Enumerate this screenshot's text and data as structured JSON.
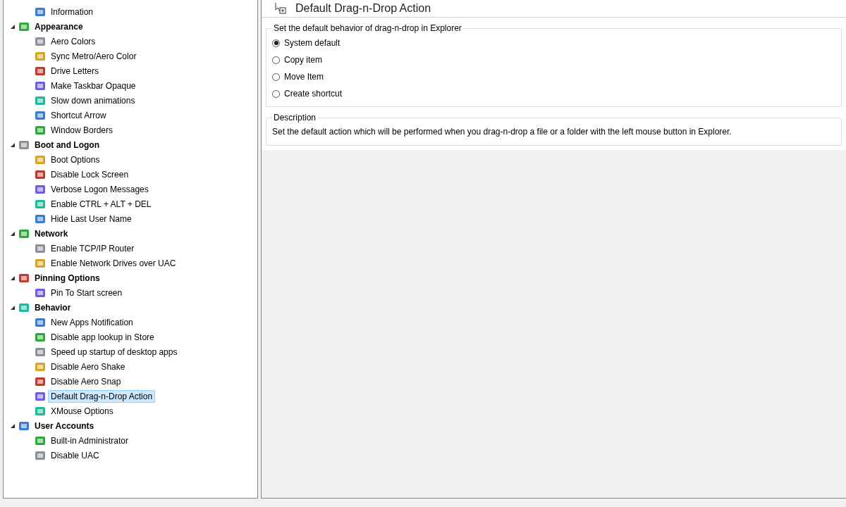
{
  "tree": {
    "items": [
      {
        "label": "Information",
        "kind": "leaf",
        "selected": false
      },
      {
        "label": "Appearance",
        "kind": "group",
        "expanded": true,
        "children": [
          {
            "label": "Aero Colors",
            "selected": false
          },
          {
            "label": "Sync Metro/Aero Color",
            "selected": false
          },
          {
            "label": "Drive Letters",
            "selected": false
          },
          {
            "label": "Make Taskbar Opaque",
            "selected": false
          },
          {
            "label": "Slow down animations",
            "selected": false
          },
          {
            "label": "Shortcut Arrow",
            "selected": false
          },
          {
            "label": "Window Borders",
            "selected": false
          }
        ]
      },
      {
        "label": "Boot and Logon",
        "kind": "group",
        "expanded": true,
        "children": [
          {
            "label": "Boot Options",
            "selected": false
          },
          {
            "label": "Disable Lock Screen",
            "selected": false
          },
          {
            "label": "Verbose Logon Messages",
            "selected": false
          },
          {
            "label": "Enable CTRL + ALT + DEL",
            "selected": false
          },
          {
            "label": "Hide Last User Name",
            "selected": false
          }
        ]
      },
      {
        "label": "Network",
        "kind": "group",
        "expanded": true,
        "children": [
          {
            "label": "Enable TCP/IP Router",
            "selected": false
          },
          {
            "label": "Enable Network Drives over UAC",
            "selected": false
          }
        ]
      },
      {
        "label": "Pinning Options",
        "kind": "group",
        "expanded": true,
        "children": [
          {
            "label": "Pin To Start screen",
            "selected": false
          }
        ]
      },
      {
        "label": "Behavior",
        "kind": "group",
        "expanded": true,
        "children": [
          {
            "label": "New Apps Notification",
            "selected": false
          },
          {
            "label": "Disable app lookup in Store",
            "selected": false
          },
          {
            "label": "Speed up startup of desktop apps",
            "selected": false
          },
          {
            "label": "Disable Aero Shake",
            "selected": false
          },
          {
            "label": "Disable Aero Snap",
            "selected": false
          },
          {
            "label": "Default Drag-n-Drop Action",
            "selected": true
          },
          {
            "label": "XMouse Options",
            "selected": false
          }
        ]
      },
      {
        "label": "User Accounts",
        "kind": "group",
        "expanded": true,
        "children": [
          {
            "label": "Built-in Administrator",
            "selected": false
          },
          {
            "label": "Disable UAC",
            "selected": false
          }
        ]
      }
    ]
  },
  "page": {
    "title": "Default Drag-n-Drop Action",
    "options_group": {
      "caption": "Set the default behavior of drag-n-drop in Explorer",
      "options": [
        {
          "label": "System default",
          "selected": true
        },
        {
          "label": "Copy item",
          "selected": false
        },
        {
          "label": "Move Item",
          "selected": false
        },
        {
          "label": "Create shortcut",
          "selected": false
        }
      ]
    },
    "description_group": {
      "caption": "Description",
      "text": "Set the default action which will be performed when you drag-n-drop a file or a folder with the left mouse button in Explorer."
    }
  }
}
